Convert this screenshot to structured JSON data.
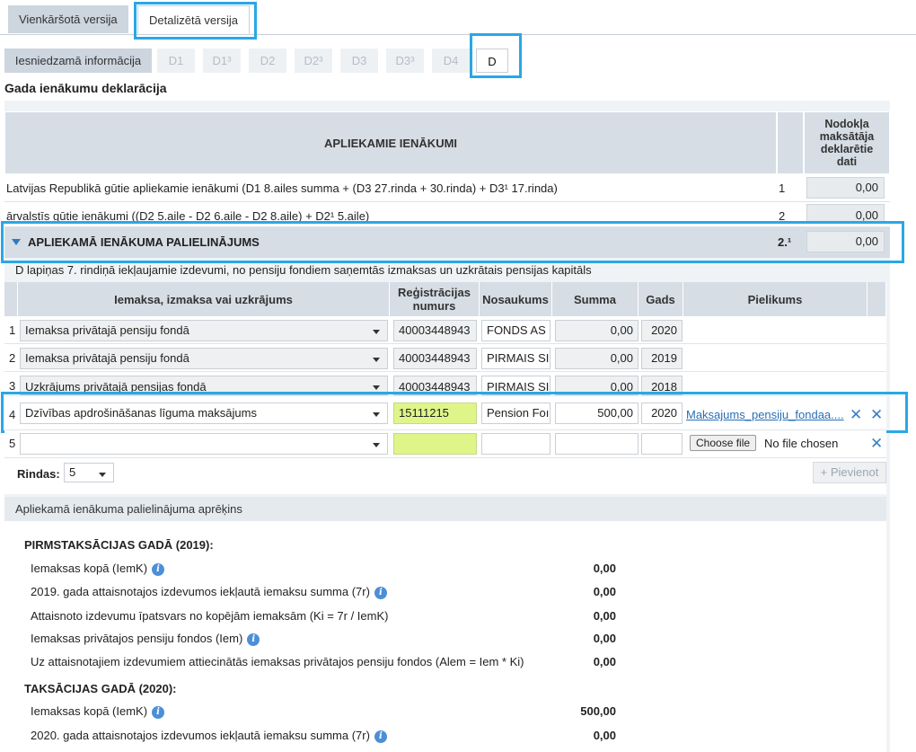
{
  "main_tabs": [
    "Vienkāršotā versija",
    "Detalizētā versija"
  ],
  "sub_tabs": [
    "Iesniedzamā informācija",
    "D1",
    "D1³",
    "D2",
    "D2³",
    "D3",
    "D3³",
    "D4",
    "D"
  ],
  "page_title": "Gada ienākumu deklarācija",
  "header": {
    "main": "APLIEKAMIE IENĀKUMI",
    "right": "Nodokļa maksātāja deklarētie dati"
  },
  "rows": [
    {
      "label": "Latvijas Republikā gūtie apliekamie ienākumi (D1 8.ailes summa + (D3 27.rinda + 30.rinda) + D3¹ 17.rinda)",
      "num": "1",
      "value": "0,00"
    },
    {
      "label": "ārvalstīs gūtie ienākumi ((D2 5.aile - D2 6.aile - D2 8.aile) + D2¹ 5.aile)",
      "num": "2",
      "value": "0,00"
    }
  ],
  "section": {
    "title": "APLIEKAMĀ IENĀKUMA PALIELINĀJUMS",
    "num": "2.¹",
    "value": "0,00"
  },
  "section_note": "D lapiņas 7. rindiņā iekļaujamie izdevumi, no pensiju fondiem saņemtās izmaksas un uzkrātais pensijas kapitāls",
  "table": {
    "columns": [
      "Iemaksa, izmaksa vai uzkrājums",
      "Reģistrācijas numurs",
      "Nosaukums",
      "Summa",
      "Gads",
      "Pielikums"
    ],
    "rows": [
      {
        "n": "1",
        "type": "Iemaksa privātajā pensiju fondā",
        "reg": "40003448943",
        "name": "FONDS AS",
        "sum": "0,00",
        "year": "2020",
        "attachment": ""
      },
      {
        "n": "2",
        "type": "Iemaksa privātajā pensiju fondā",
        "reg": "40003448943",
        "name": "PIRMAIS SI",
        "sum": "0,00",
        "year": "2019",
        "attachment": ""
      },
      {
        "n": "3",
        "type": "Uzkrājums privātajā pensijas fondā",
        "reg": "40003448943",
        "name": "PIRMAIS SI",
        "sum": "0,00",
        "year": "2018",
        "attachment": ""
      },
      {
        "n": "4",
        "type": "Dzīvības apdrošināšanas līguma maksājums",
        "reg": "15111215",
        "name": "Pension Foı",
        "sum": "500,00",
        "year": "2020",
        "attachment": "Maksajums_pensiju_fondaa...."
      },
      {
        "n": "5",
        "type": "",
        "reg": "",
        "name": "",
        "sum": "",
        "year": "",
        "attachment": ""
      }
    ],
    "choose_file": "Choose file",
    "no_file": "No file chosen",
    "rows_label": "Rindas:",
    "rows_value": "5",
    "add_button": "+ Pievienot"
  },
  "calc": {
    "header": "Apliekamā ienākuma palielinājuma aprēķins",
    "pre_title": "PIRMSTAKSĀCIJAS GADĀ (2019):",
    "pre_lines": [
      {
        "label": "Iemaksas kopā (IemK)",
        "info": true,
        "value": "0,00"
      },
      {
        "label": "2019. gada attaisnotajos izdevumos iekļautā iemaksu summa (7r)",
        "info": true,
        "value": "0,00"
      },
      {
        "label": "Attaisnoto izdevumu īpatsvars no kopējām iemaksām (Ki = 7r / IemK)",
        "info": false,
        "value": "0,00"
      },
      {
        "label": "Iemaksas privātajos pensiju fondos (Iem)",
        "info": true,
        "value": "0,00"
      },
      {
        "label": "Uz attaisnotajiem izdevumiem attiecinātās iemaksas privātajos pensiju fondos (Alem = Iem * Ki)",
        "info": false,
        "value": "0,00"
      }
    ],
    "tax_title": "TAKSĀCIJAS GADĀ (2020):",
    "tax_lines": [
      {
        "label": "Iemaksas kopā (IemK)",
        "info": true,
        "value": "500,00"
      },
      {
        "label": "2020. gada attaisnotajos izdevumos iekļautā iemaksu summa (7r)",
        "info": true,
        "value": "0,00"
      }
    ]
  }
}
